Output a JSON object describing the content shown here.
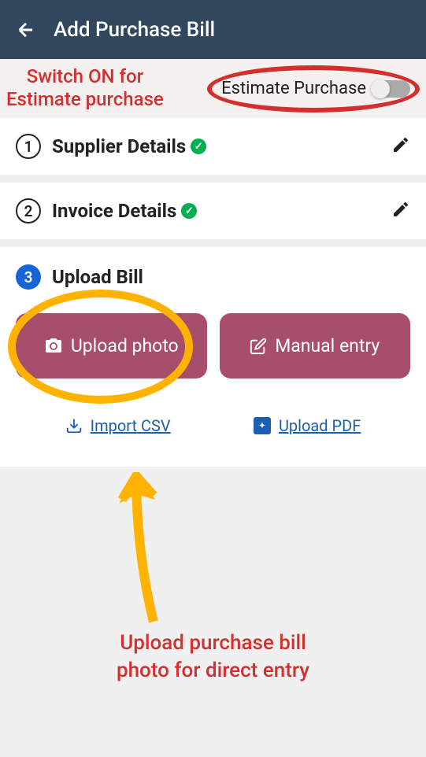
{
  "header": {
    "title": "Add Purchase Bill"
  },
  "annotations": {
    "switchOn": "Switch ON for\nEstimate purchase",
    "uploadPhoto": "Upload purchase bill\nphoto for direct entry"
  },
  "estimate": {
    "label": "Estimate Purchase",
    "enabled": false
  },
  "steps": {
    "s1": {
      "number": "1",
      "title": "Supplier Details",
      "completed": true
    },
    "s2": {
      "number": "2",
      "title": "Invoice Details",
      "completed": true
    },
    "s3": {
      "number": "3",
      "title": "Upload Bill",
      "completed": false
    }
  },
  "buttons": {
    "uploadPhoto": "Upload photo",
    "manualEntry": "Manual entry"
  },
  "links": {
    "importCsv": "Import CSV",
    "uploadPdf": "Upload PDF"
  }
}
